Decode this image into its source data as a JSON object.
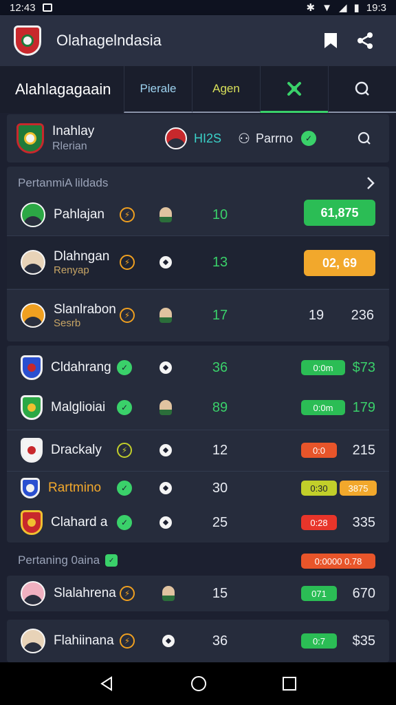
{
  "status": {
    "time": "12:43",
    "clock_right": "19:3"
  },
  "appbar": {
    "title": "Olahagelndasia"
  },
  "tabs": {
    "brand": "Alahlagagaain",
    "t1": "Pierale",
    "t2": "Agen"
  },
  "hero": {
    "name": "Inahlay",
    "sub": "Rlerian",
    "mid": "HI2S",
    "right": "Parrno"
  },
  "section1": {
    "title": "PertanmiA lildads"
  },
  "rows_top": [
    {
      "name": "Pahlajan",
      "sub": "",
      "num": "10",
      "pill": "61,875"
    },
    {
      "name": "Dlahngan",
      "sub": "Renyap",
      "num": "13",
      "pill": "02, 69"
    },
    {
      "name": "Slanlrabon",
      "sub": "Sesrb",
      "num": "17",
      "v1": "19",
      "v2": "236"
    }
  ],
  "rows_mid": [
    {
      "name": "Cldahrang",
      "num": "36",
      "tag": "0:0m",
      "val": "$73"
    },
    {
      "name": "Malglioiai",
      "num": "89",
      "tag": "0:0m",
      "val": "179"
    },
    {
      "name": "Drackaly",
      "num": "12",
      "tag": "0:0",
      "val": "215"
    },
    {
      "name": "Rartmino",
      "num": "30",
      "tag": "0:30",
      "tag2": "3875",
      "val": ""
    },
    {
      "name": "Clahard a",
      "num": "25",
      "tag": "0:28",
      "val": "335"
    }
  ],
  "section2": {
    "title": "Pertaning 0aina",
    "tag": "0:0000 0.78"
  },
  "rows_bottom": [
    {
      "name": "Slalahrena",
      "num": "15",
      "tag": "071",
      "val": "670"
    },
    {
      "name": "Flahiinana",
      "num": "36",
      "tag": "0:7",
      "val": "$35"
    }
  ],
  "colors": {
    "accent_green": "#3ad16a",
    "accent_orange": "#f2a82c",
    "bg": "#1c2030",
    "card": "#262c3c"
  }
}
